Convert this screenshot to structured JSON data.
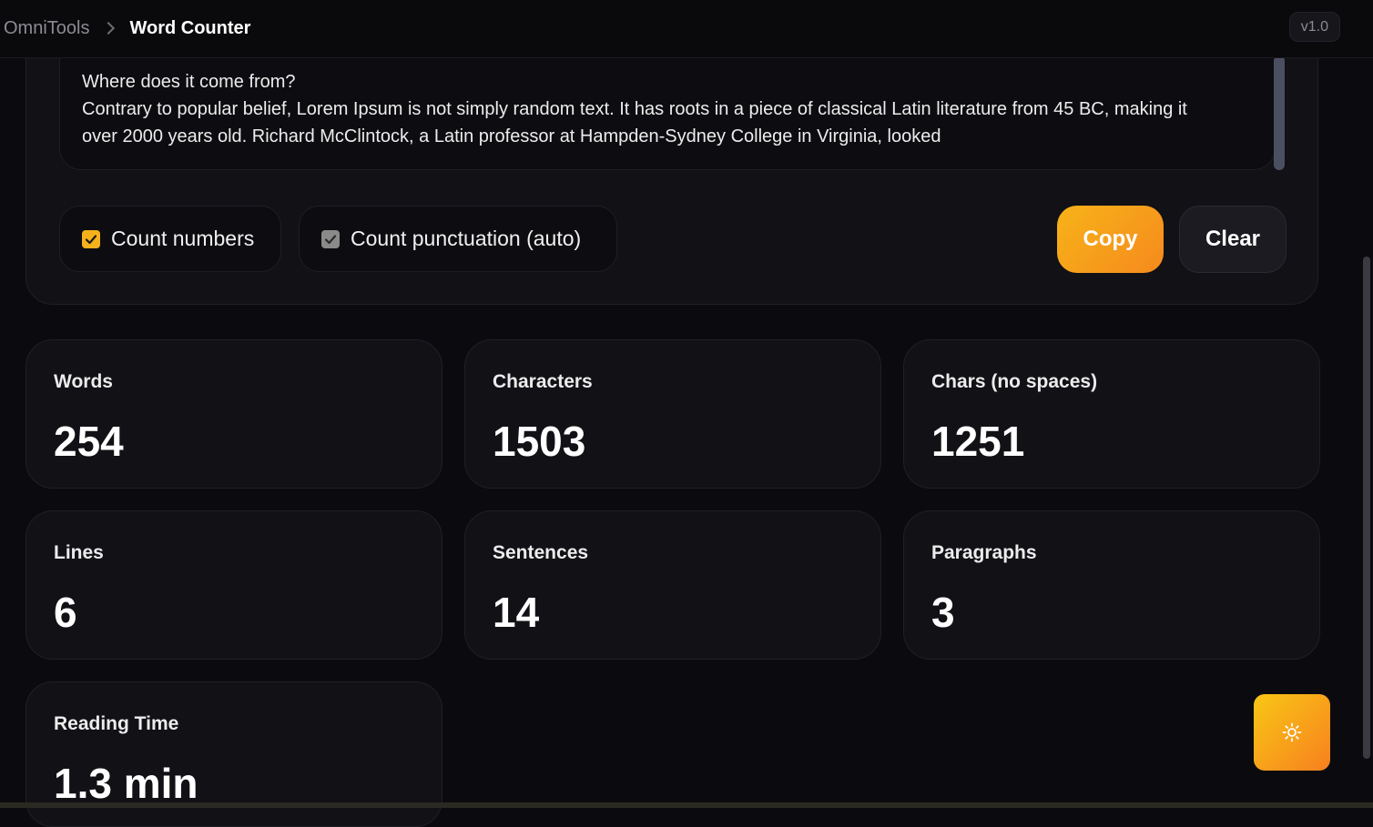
{
  "header": {
    "brand": "OmniTools",
    "current": "Word Counter",
    "version": "v1.0"
  },
  "editor": {
    "lines": [
      "Where does it come from?",
      "Contrary to popular belief, Lorem Ipsum is not simply random text. It has roots in a piece of classical Latin literature from 45 BC, making it",
      "over 2000 years old. Richard McClintock, a Latin professor at Hampden-Sydney College in Virginia, looked"
    ]
  },
  "options": {
    "count_numbers": {
      "label": "Count numbers",
      "checked": true
    },
    "count_punctuation": {
      "label": "Count punctuation (auto)",
      "checked": true,
      "disabled": true
    }
  },
  "actions": {
    "copy": "Copy",
    "clear": "Clear"
  },
  "stats": {
    "words": {
      "label": "Words",
      "value": "254"
    },
    "characters": {
      "label": "Characters",
      "value": "1503"
    },
    "chars_no_spaces": {
      "label": "Chars (no spaces)",
      "value": "1251"
    },
    "lines": {
      "label": "Lines",
      "value": "6"
    },
    "sentences": {
      "label": "Sentences",
      "value": "14"
    },
    "paragraphs": {
      "label": "Paragraphs",
      "value": "3"
    },
    "reading_time": {
      "label": "Reading Time",
      "value": "1.3 min"
    }
  },
  "theme_toggle": {
    "icon": "sun-icon"
  },
  "colors": {
    "accent": "#f5b11b",
    "accent_end": "#f68a1e",
    "background": "#0b0b0f",
    "card": "#111116"
  }
}
